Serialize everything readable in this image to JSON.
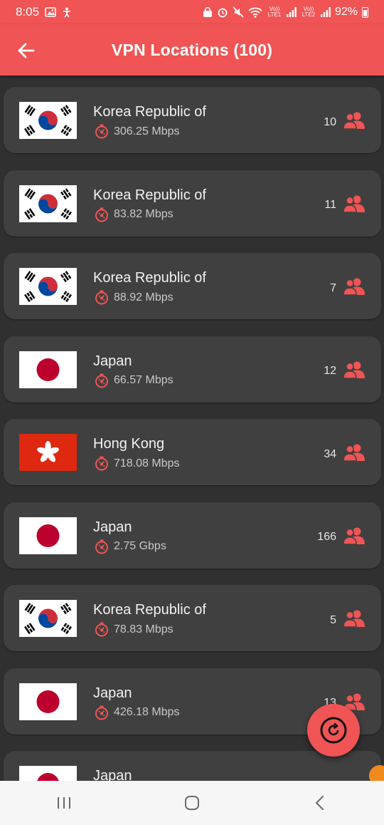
{
  "status_bar": {
    "time": "8:05",
    "lte1": "Vo)) LTE1",
    "lte2": "Vo)) LTE2",
    "battery": "92%"
  },
  "app_bar": {
    "title": "VPN Locations (100)",
    "back_icon": "arrow-back-icon"
  },
  "colors": {
    "accent": "#f05454",
    "card": "#404040",
    "background": "#303030"
  },
  "servers": [
    {
      "country": "Korea Republic of",
      "flag": "kr",
      "speed": "306.25 Mbps",
      "users": "10"
    },
    {
      "country": "Korea Republic of",
      "flag": "kr",
      "speed": "83.82 Mbps",
      "users": "11"
    },
    {
      "country": "Korea Republic of",
      "flag": "kr",
      "speed": "88.92 Mbps",
      "users": "7"
    },
    {
      "country": "Japan",
      "flag": "jp",
      "speed": "66.57 Mbps",
      "users": "12"
    },
    {
      "country": "Hong Kong",
      "flag": "hk",
      "speed": "718.08 Mbps",
      "users": "34"
    },
    {
      "country": "Japan",
      "flag": "jp",
      "speed": "2.75 Gbps",
      "users": "166"
    },
    {
      "country": "Korea Republic of",
      "flag": "kr",
      "speed": "78.83 Mbps",
      "users": "5"
    },
    {
      "country": "Japan",
      "flag": "jp",
      "speed": "426.18 Mbps",
      "users": "13"
    },
    {
      "country": "Japan",
      "flag": "jp",
      "speed": "",
      "users": ""
    }
  ],
  "fab": {
    "icon": "refresh-icon"
  },
  "nav": {
    "recent": "recent-apps-icon",
    "home": "home-icon",
    "back": "back-icon"
  }
}
